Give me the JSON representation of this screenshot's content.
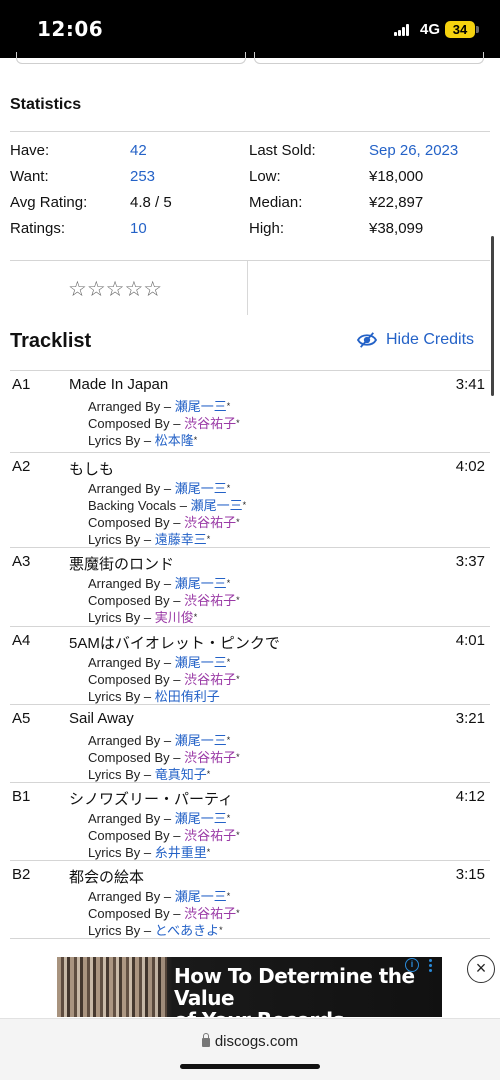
{
  "status_bar": {
    "time": "12:06",
    "network": "4G",
    "battery": "34"
  },
  "statistics": {
    "title": "Statistics",
    "left": [
      {
        "label": "Have:",
        "value": "42"
      },
      {
        "label": "Want:",
        "value": "253"
      },
      {
        "label": "Avg Rating:",
        "value": "4.8 / 5"
      },
      {
        "label": "Ratings:",
        "value": "10"
      }
    ],
    "right": [
      {
        "label": "Last Sold:",
        "value": "Sep 26, 2023"
      },
      {
        "label": "Low:",
        "value": "¥18,000"
      },
      {
        "label": "Median:",
        "value": "¥22,897"
      },
      {
        "label": "High:",
        "value": "¥38,099"
      }
    ],
    "stars": "☆☆☆☆☆"
  },
  "tracklist": {
    "title": "Tracklist",
    "hide_credits_label": "Hide Credits",
    "tracks": [
      {
        "pos": "A1",
        "title": "Made In Japan",
        "duration": "3:41",
        "credits": [
          {
            "role": "Arranged By –",
            "name": "瀬尾一三",
            "star": true,
            "color": "blue"
          },
          {
            "role": "Composed By –",
            "name": "渋谷祐子",
            "star": true,
            "color": "purple"
          },
          {
            "role": "Lyrics By –",
            "name": "松本隆",
            "star": true,
            "color": "blue"
          }
        ]
      },
      {
        "pos": "A2",
        "title": "もしも",
        "duration": "4:02",
        "credits": [
          {
            "role": "Arranged By –",
            "name": "瀬尾一三",
            "star": true,
            "color": "blue"
          },
          {
            "role": "Backing Vocals –",
            "name": "瀬尾一三",
            "star": true,
            "color": "blue"
          },
          {
            "role": "Composed By –",
            "name": "渋谷祐子",
            "star": true,
            "color": "purple"
          },
          {
            "role": "Lyrics By –",
            "name": "遠藤幸三",
            "star": true,
            "color": "blue"
          }
        ]
      },
      {
        "pos": "A3",
        "title": "悪魔街のロンド",
        "duration": "3:37",
        "credits": [
          {
            "role": "Arranged By –",
            "name": "瀬尾一三",
            "star": true,
            "color": "blue"
          },
          {
            "role": "Composed By –",
            "name": "渋谷祐子",
            "star": true,
            "color": "purple"
          },
          {
            "role": "Lyrics By –",
            "name": "実川俊",
            "star": true,
            "color": "purple"
          }
        ]
      },
      {
        "pos": "A4",
        "title": "5AMはバイオレット・ピンクで",
        "duration": "4:01",
        "credits": [
          {
            "role": "Arranged By –",
            "name": "瀬尾一三",
            "star": true,
            "color": "blue"
          },
          {
            "role": "Composed By –",
            "name": "渋谷祐子",
            "star": true,
            "color": "purple"
          },
          {
            "role": "Lyrics By –",
            "name": "松田侑利子",
            "star": false,
            "color": "blue"
          }
        ]
      },
      {
        "pos": "A5",
        "title": "Sail Away",
        "duration": "3:21",
        "credits": [
          {
            "role": "Arranged By –",
            "name": "瀬尾一三",
            "star": true,
            "color": "blue"
          },
          {
            "role": "Composed By –",
            "name": "渋谷祐子",
            "star": true,
            "color": "purple"
          },
          {
            "role": "Lyrics By –",
            "name": "竜真知子",
            "star": true,
            "color": "blue"
          }
        ]
      },
      {
        "pos": "B1",
        "title": "シノワズリー・パーティ",
        "duration": "4:12",
        "credits": [
          {
            "role": "Arranged By –",
            "name": "瀬尾一三",
            "star": true,
            "color": "blue"
          },
          {
            "role": "Composed By –",
            "name": "渋谷祐子",
            "star": true,
            "color": "purple"
          },
          {
            "role": "Lyrics By –",
            "name": "糸井重里",
            "star": true,
            "color": "blue"
          }
        ]
      },
      {
        "pos": "B2",
        "title": "都会の絵本",
        "duration": "3:15",
        "credits": [
          {
            "role": "Arranged By –",
            "name": "瀬尾一三",
            "star": true,
            "color": "blue"
          },
          {
            "role": "Composed By –",
            "name": "渋谷祐子",
            "star": true,
            "color": "purple"
          },
          {
            "role": "Lyrics By –",
            "name": "とべあきよ",
            "star": true,
            "color": "blue"
          }
        ]
      }
    ]
  },
  "ad": {
    "line1": "How To Determine the Value",
    "line2": "of Your Records",
    "close": "×",
    "info": "i"
  },
  "browser": {
    "url": "discogs.com"
  },
  "colors": {
    "link_blue": "#2462c7",
    "link_purple": "#9a3aa6",
    "battery": "#f5d20f"
  }
}
